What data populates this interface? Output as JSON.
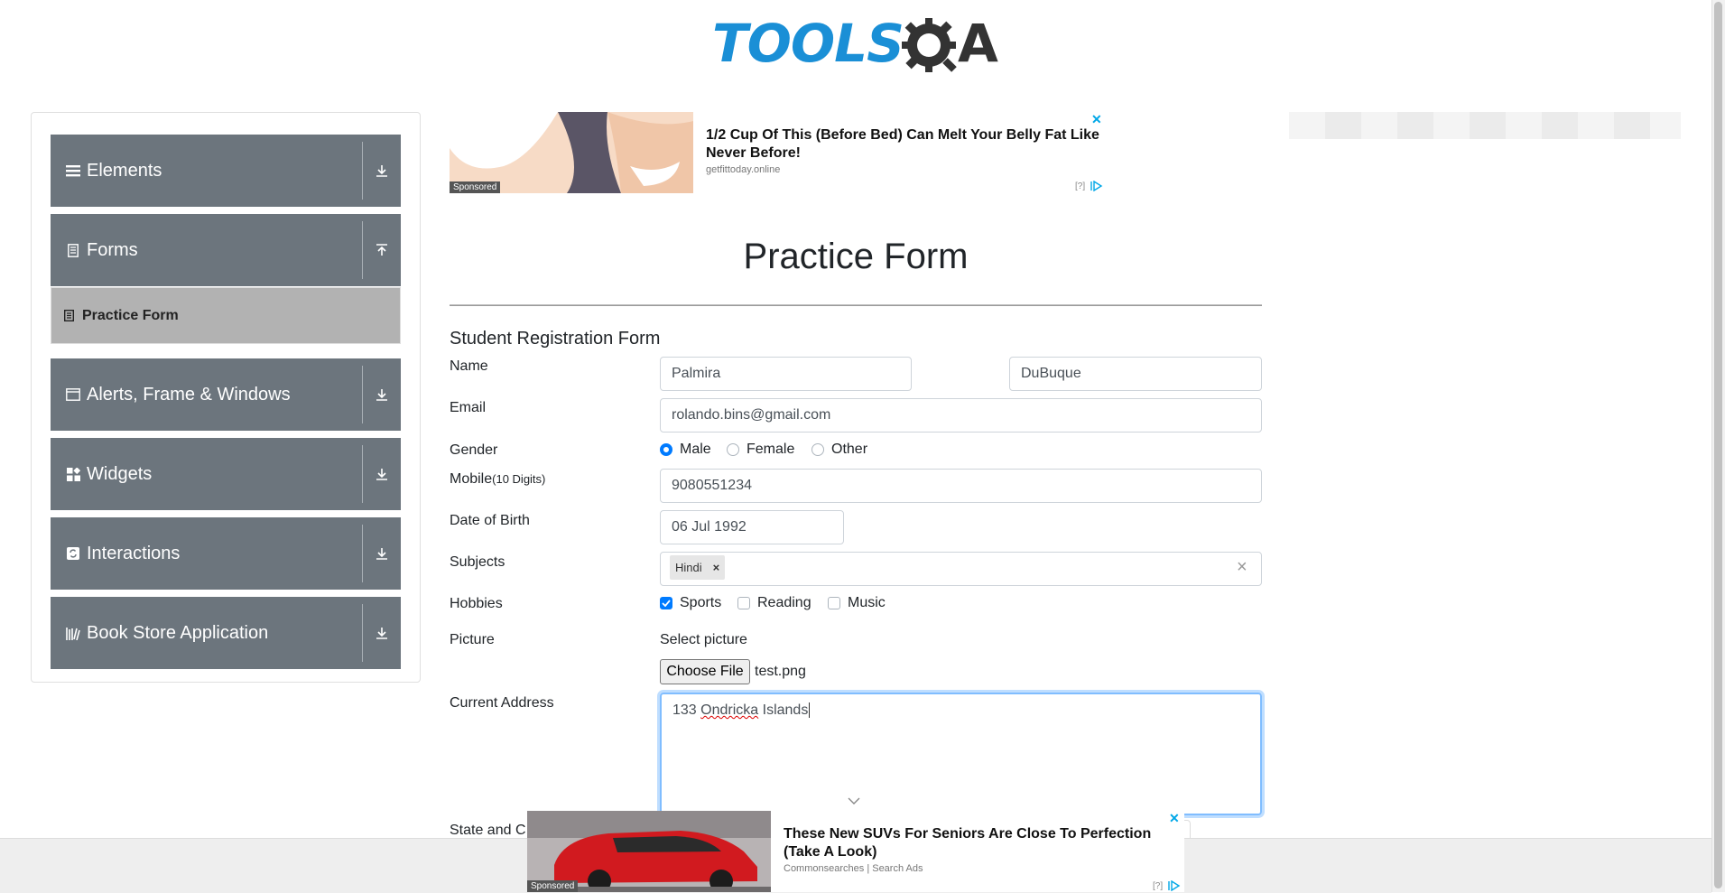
{
  "logo": {
    "text": "TOOLS",
    "letter": "A"
  },
  "sidebar": {
    "groups": [
      {
        "label": "Elements",
        "icon": "hamburger-icon",
        "arrow": "download-icon"
      },
      {
        "label": "Forms",
        "icon": "document-icon",
        "arrow": "upload-icon"
      },
      {
        "label": "Alerts, Frame & Windows",
        "icon": "window-icon",
        "arrow": "download-icon"
      },
      {
        "label": "Widgets",
        "icon": "widgets-icon",
        "arrow": "download-icon"
      },
      {
        "label": "Interactions",
        "icon": "interactions-icon",
        "arrow": "download-icon"
      },
      {
        "label": "Book Store Application",
        "icon": "books-icon",
        "arrow": "download-icon"
      }
    ],
    "active_item": {
      "label": "Practice Form",
      "icon": "form-icon"
    }
  },
  "ad_top": {
    "title": "1/2 Cup Of This (Before Bed) Can Melt Your Belly Fat Like Never Before!",
    "source": "getfittoday.online",
    "sponsored": "Sponsored",
    "info": "[?]",
    "close": "✕"
  },
  "ad_bottom": {
    "title": "These New SUVs For Seniors Are Close To Perfection (Take A Look)",
    "source": "Commonsearches | Search Ads",
    "sponsored": "Sponsored",
    "info": "[?]",
    "close": "✕"
  },
  "page": {
    "title": "Practice Form",
    "subtitle": "Student Registration Form"
  },
  "form": {
    "name_label": "Name",
    "first_name": "Palmira",
    "last_name": "DuBuque",
    "email_label": "Email",
    "email": "rolando.bins@gmail.com",
    "gender_label": "Gender",
    "gender_options": [
      "Male",
      "Female",
      "Other"
    ],
    "gender_selected": "Male",
    "mobile_label": "Mobile",
    "mobile_hint": "(10 Digits)",
    "mobile": "9080551234",
    "dob_label": "Date of Birth",
    "dob": "06 Jul 1992",
    "subjects_label": "Subjects",
    "subject_chip": "Hindi",
    "chip_remove": "×",
    "subjects_clear": "×",
    "hobbies_label": "Hobbies",
    "hobbies": [
      "Sports",
      "Reading",
      "Music"
    ],
    "hobbies_checked": [
      "Sports"
    ],
    "picture_label": "Picture",
    "select_picture": "Select picture",
    "choose_file": "Choose File",
    "file_name": "test.png",
    "address_label": "Current Address",
    "address_number": "133",
    "address_word": "Ondricka",
    "address_rest": " Islands",
    "state_label": "State and C"
  }
}
